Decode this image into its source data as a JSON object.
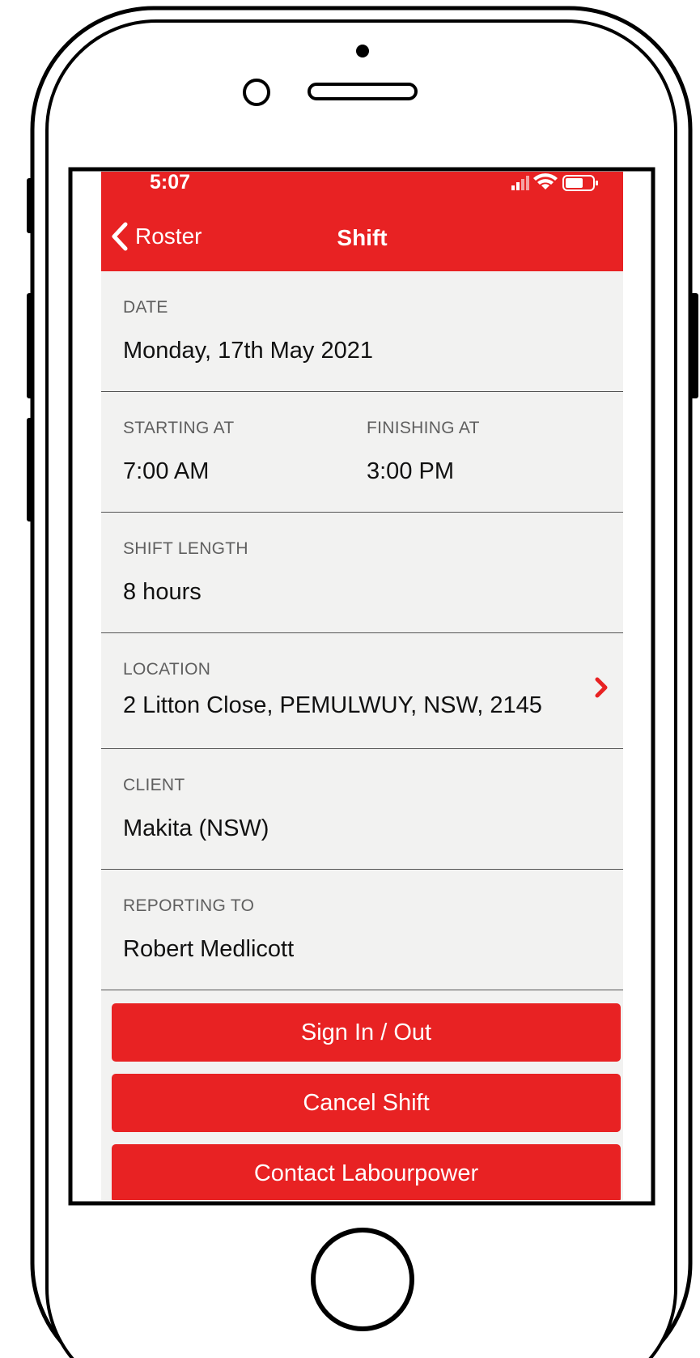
{
  "status_bar": {
    "time": "5:07",
    "icons": [
      "cellular-signal-icon",
      "wifi-icon",
      "battery-icon"
    ]
  },
  "nav": {
    "back_label": "Roster",
    "title": "Shift"
  },
  "details": {
    "date": {
      "label": "DATE",
      "value": "Monday, 17th May 2021"
    },
    "start": {
      "label": "STARTING AT",
      "value": "7:00 AM"
    },
    "finish": {
      "label": "FINISHING AT",
      "value": "3:00 PM"
    },
    "length": {
      "label": "SHIFT LENGTH",
      "value": "8 hours"
    },
    "location": {
      "label": "LOCATION",
      "value": "2 Litton Close, PEMULWUY, NSW, 2145"
    },
    "client": {
      "label": "CLIENT",
      "value": "Makita (NSW)"
    },
    "reporting": {
      "label": "REPORTING TO",
      "value": "Robert Medlicott"
    }
  },
  "actions": {
    "sign_in_out": "Sign In / Out",
    "cancel_shift": "Cancel Shift",
    "contact": "Contact Labourpower"
  },
  "colors": {
    "accent": "#e82223",
    "background": "#f2f2f1",
    "label_text": "#5f5f5f"
  }
}
